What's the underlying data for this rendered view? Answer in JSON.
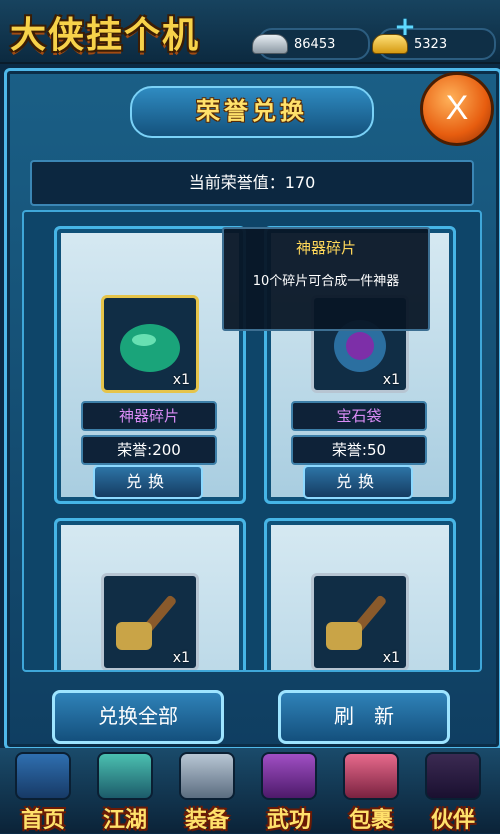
{
  "header": {
    "logo": "大侠挂个机",
    "silver": "86453",
    "gold": "5323",
    "plus": "+"
  },
  "panel": {
    "title": "荣誉兑换",
    "close": "X",
    "honor_label": "当前荣誉值：170"
  },
  "items": [
    {
      "name": "神器碎片",
      "cost": "荣誉:200",
      "qty": "x1",
      "button": "兑换"
    },
    {
      "name": "宝石袋",
      "cost": "荣誉:50",
      "qty": "x1",
      "button": "兑换"
    },
    {
      "qty": "x1"
    },
    {
      "qty": "x1"
    }
  ],
  "tooltip": {
    "title": "神器碎片",
    "desc": "10个碎片可合成一件神器"
  },
  "actions": {
    "exchange_all": "兑换全部",
    "refresh": "刷　新"
  },
  "nav": [
    "首页",
    "江湖",
    "装备",
    "武功",
    "包裹",
    "伙伴"
  ],
  "colors": {
    "accent": "#46b5e6",
    "title_gold": "#ffe16b",
    "item_name": "#d98cf5"
  }
}
